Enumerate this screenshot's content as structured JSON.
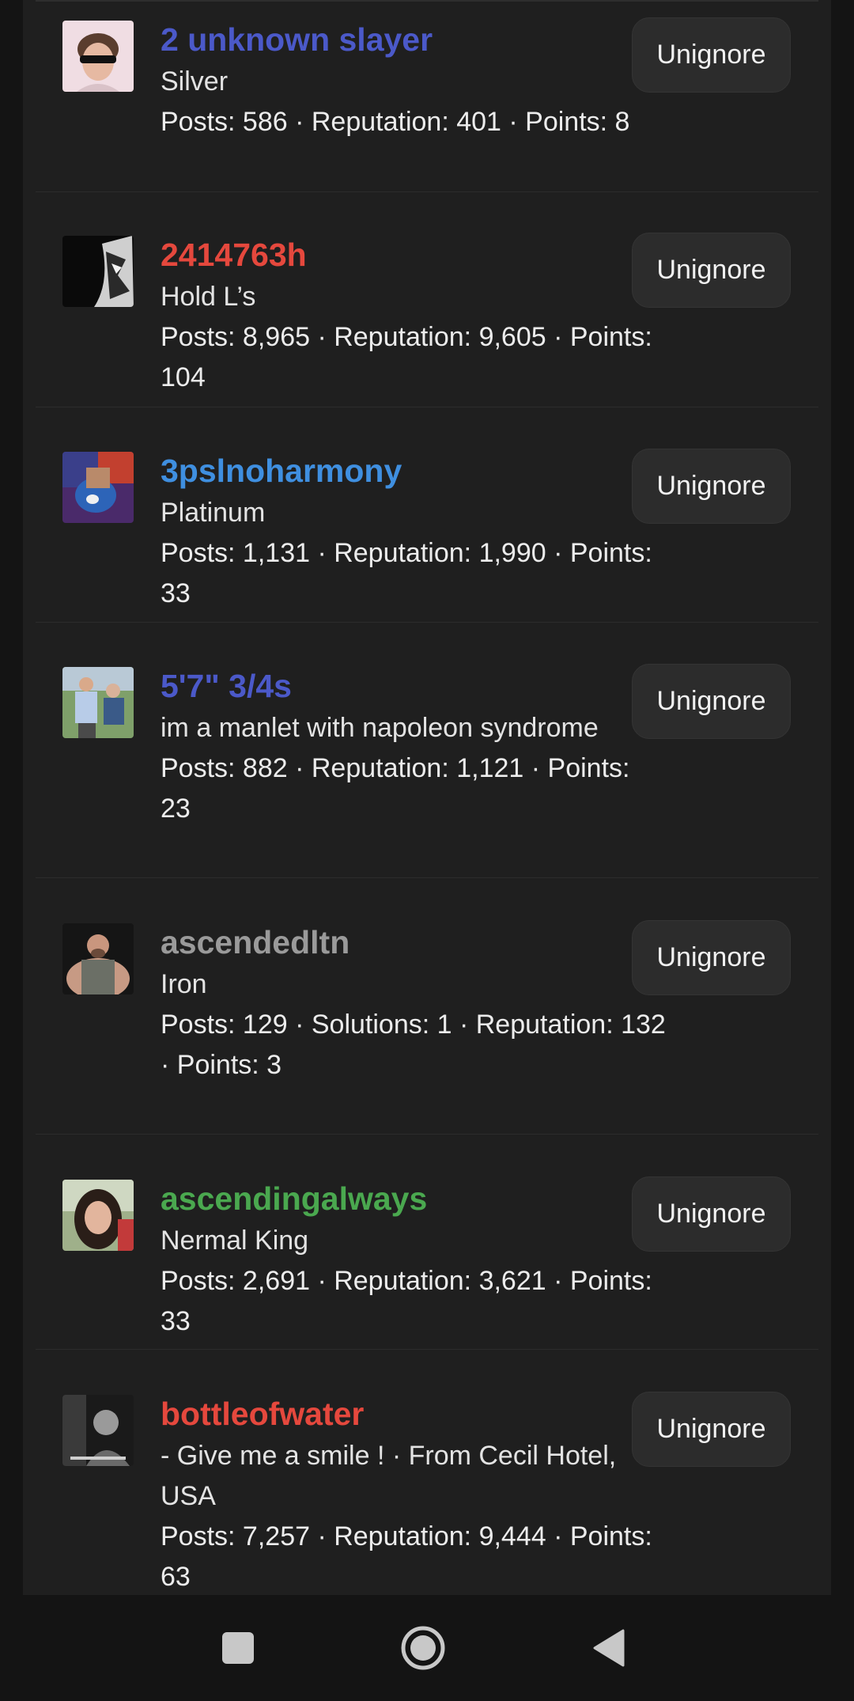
{
  "ignored_users": [
    {
      "username": "2 unknown slayer",
      "username_color": "#4b59c9",
      "title": "Silver",
      "stats": "Posts: 586 · Reputation: 401 · Points: 8",
      "avatar_icon": "avatar-sunglasses-boy",
      "button_label": "Unignore"
    },
    {
      "username": "2414763h",
      "username_color": "#e5483d",
      "title": "Hold L’s",
      "stats": "Posts: 8,965 · Reputation: 9,605 · Points: 104",
      "avatar_icon": "avatar-dark-anime",
      "button_label": "Unignore"
    },
    {
      "username": "3pslnoharmony",
      "username_color": "#3f8fe0",
      "title": "Platinum",
      "stats": "Posts: 1,131 · Reputation: 1,990 · Points: 33",
      "avatar_icon": "avatar-cartoon",
      "button_label": "Unignore"
    },
    {
      "username": "5'7\" 3/4s",
      "username_color": "#4b59c9",
      "title": "im a manlet with napoleon syndrome",
      "stats": "Posts: 882 · Reputation: 1,121 · Points: 23",
      "avatar_icon": "avatar-two-people",
      "button_label": "Unignore"
    },
    {
      "username": "ascendedltn",
      "username_color": "#9a9a9a",
      "title": "Iron",
      "stats": "Posts: 129 · Solutions: 1 · Reputation: 132 · Points: 3",
      "avatar_icon": "avatar-bodybuilder",
      "button_label": "Unignore"
    },
    {
      "username": "ascendingalways",
      "username_color": "#4aa84f",
      "title": "Nermal King",
      "stats": "Posts: 2,691 · Reputation: 3,621 · Points: 33",
      "avatar_icon": "avatar-girl",
      "button_label": "Unignore"
    },
    {
      "username": "bottleofwater",
      "username_color": "#e5483d",
      "title": "- Give me a smile ! · From Cecil Hotel, USA",
      "stats": "Posts: 7,257 · Reputation: 9,444 · Points: 63",
      "avatar_icon": "avatar-monochrome",
      "button_label": "Unignore"
    }
  ],
  "nav": {
    "recents_icon": "square-icon",
    "home_icon": "circle-home-icon",
    "back_icon": "triangle-back-icon"
  }
}
